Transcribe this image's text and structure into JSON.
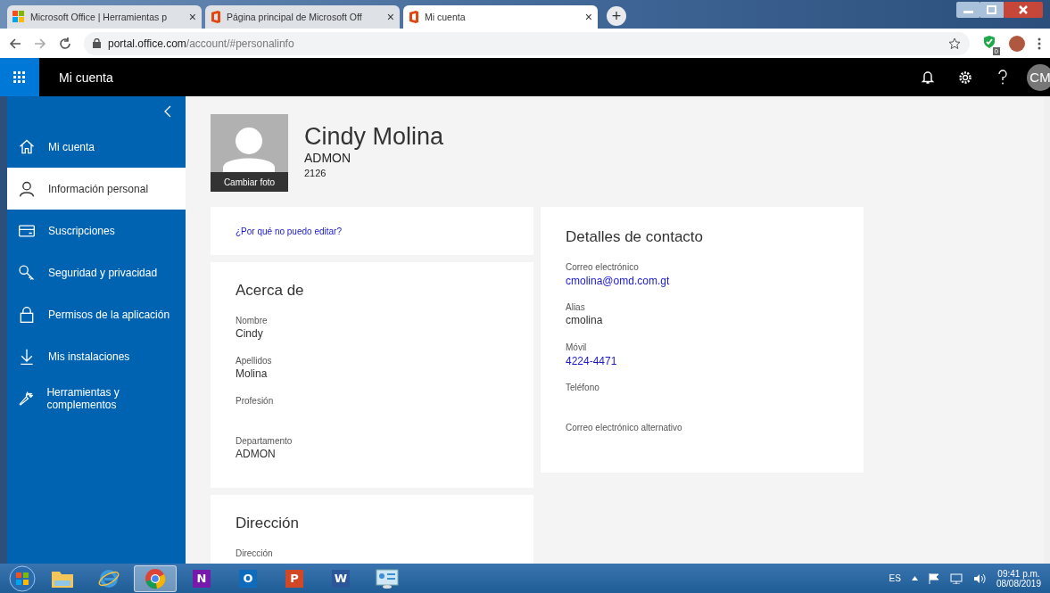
{
  "browser": {
    "tabs": [
      {
        "title": "Microsoft Office | Herramientas p",
        "kind": "windows",
        "selected": false
      },
      {
        "title": "Página principal de Microsoft Off",
        "kind": "office",
        "selected": false
      },
      {
        "title": "Mi cuenta",
        "kind": "office",
        "selected": true
      }
    ],
    "close_label": "×",
    "new_tab_label": "+",
    "url_host": "portal.office.com",
    "url_path": "/account/#personalinfo",
    "extension_badge": "0"
  },
  "header": {
    "title": "Mi cuenta",
    "avatar_initials": "CM"
  },
  "sidebar": {
    "items": [
      {
        "label": "Mi cuenta",
        "kind": "home",
        "selected": false
      },
      {
        "label": "Información personal",
        "kind": "person",
        "selected": true
      },
      {
        "label": "Suscripciones",
        "kind": "card",
        "selected": false
      },
      {
        "label": "Seguridad y privacidad",
        "kind": "key",
        "selected": false
      },
      {
        "label": "Permisos de la aplicación",
        "kind": "lock",
        "selected": false
      },
      {
        "label": "Mis instalaciones",
        "kind": "download",
        "selected": false
      },
      {
        "label": "Herramientas y complementos",
        "kind": "wrench",
        "selected": false
      }
    ]
  },
  "profile": {
    "name": "Cindy Molina",
    "department": "ADMON",
    "extension": "2126",
    "photo_action": "Cambiar foto"
  },
  "edit_link": "¿Por qué no puedo editar?",
  "about": {
    "title": "Acerca de",
    "fields": [
      {
        "label": "Nombre",
        "value": "Cindy"
      },
      {
        "label": "Apellidos",
        "value": "Molina"
      },
      {
        "label": "Profesión"
      },
      {
        "label": "Departamento",
        "value": "ADMON"
      }
    ]
  },
  "address": {
    "title": "Dirección",
    "fields": [
      {
        "label": "Dirección"
      }
    ]
  },
  "contact": {
    "title": "Detalles de contacto",
    "fields": [
      {
        "label": "Correo electrónico",
        "value": "cmolina@omd.com.gt",
        "kind": "link"
      },
      {
        "label": "Alias",
        "value": "cmolina",
        "kind": "text"
      },
      {
        "label": "Móvil",
        "value": "4224-4471",
        "kind": "link"
      },
      {
        "label": "Teléfono"
      },
      {
        "label": "Correo electrónico alternativo"
      }
    ]
  },
  "taskbar": {
    "apps": [
      {
        "kind": "explorer",
        "selected": false
      },
      {
        "kind": "ie",
        "selected": false
      },
      {
        "kind": "chrome",
        "selected": true
      },
      {
        "kind": "office",
        "letter": "N",
        "color": "#7719aa",
        "selected": false
      },
      {
        "kind": "office",
        "letter": "O",
        "color": "#0f6cbd",
        "selected": false
      },
      {
        "kind": "office",
        "letter": "P",
        "color": "#d24726",
        "selected": false
      },
      {
        "kind": "office",
        "letter": "W",
        "color": "#2b579a",
        "selected": false
      },
      {
        "kind": "panel",
        "selected": false
      }
    ],
    "language": "ES",
    "time": "09:41 p.m.",
    "date": "08/08/2019"
  }
}
